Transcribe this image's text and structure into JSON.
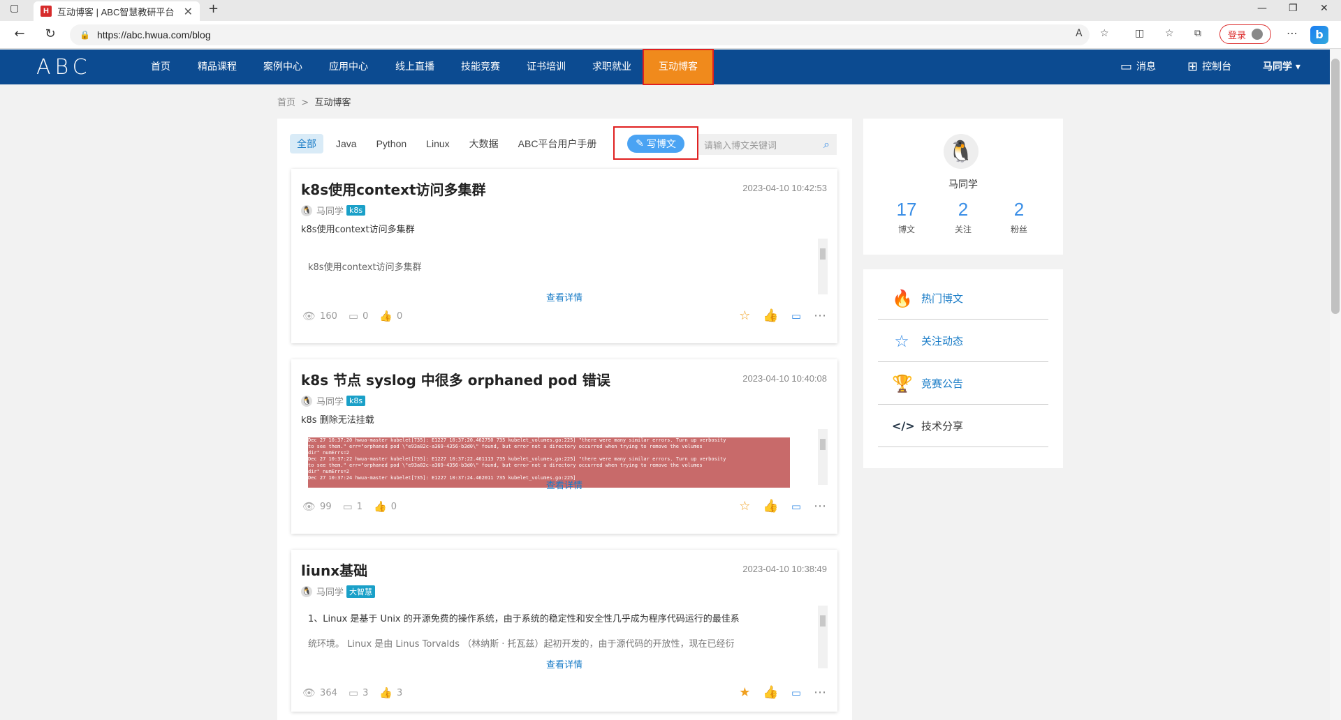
{
  "browser": {
    "tab_title": "互动博客 | ABC智慧教研平台",
    "url": "https://abc.hwua.com/blog",
    "login_label": "登录"
  },
  "site": {
    "logo": "ABC",
    "nav": [
      "首页",
      "精品课程",
      "案例中心",
      "应用中心",
      "线上直播",
      "技能竞赛",
      "证书培训",
      "求职就业",
      "互动博客"
    ],
    "active_nav": "互动博客",
    "messages_label": "消息",
    "console_label": "控制台",
    "user_label": "马同学 ▾"
  },
  "breadcrumb": {
    "home": "首页",
    "sep": ">",
    "current": "互动博客"
  },
  "filters": [
    "全部",
    "Java",
    "Python",
    "Linux",
    "大数据",
    "ABC平台用户手册"
  ],
  "write_label": "写博文",
  "search_placeholder": "请输入博文关键词",
  "posts": [
    {
      "title": "k8s使用context访问多集群",
      "date": "2023-04-10 10:42:53",
      "author": "马同学",
      "tag": "k8s",
      "summary": "k8s使用context访问多集群",
      "body": "k8s使用context访问多集群",
      "more": "查看详情",
      "views": "160",
      "comments": "0",
      "likes": "0"
    },
    {
      "title": "k8s 节点 syslog 中很多 orphaned pod 错误",
      "date": "2023-04-10 10:40:08",
      "author": "马同学",
      "tag": "k8s",
      "summary": "k8s 删除无法挂载",
      "more": "查看详情",
      "views": "99",
      "comments": "1",
      "likes": "0"
    },
    {
      "title": "liunx基础",
      "date": "2023-04-10 10:38:49",
      "author": "马同学",
      "tag": "大智慧",
      "body_line1": "1、Linux 是基于 Unix 的开源免费的操作系统，由于系统的稳定性和安全性几乎成为程序代码运行的最佳系",
      "body_line2": "统环境。 Linux 是由 Linus Torvalds （林纳斯 · 托瓦兹）起初开发的，由于源代码的开放性，现在已经衍",
      "more": "查看详情",
      "views": "364",
      "comments": "3",
      "likes": "3"
    }
  ],
  "profile": {
    "name": "马同学",
    "stats": [
      {
        "value": "17",
        "label": "博文"
      },
      {
        "value": "2",
        "label": "关注"
      },
      {
        "value": "2",
        "label": "粉丝"
      }
    ]
  },
  "side_menu": [
    "热门博文",
    "关注动态",
    "竞赛公告",
    "技术分享"
  ],
  "colors": {
    "header": "#0c4b91",
    "active_nav": "#f08a1c",
    "accent": "#3a8ee6",
    "star": "#f0a020",
    "thumb": "#e8553a"
  }
}
